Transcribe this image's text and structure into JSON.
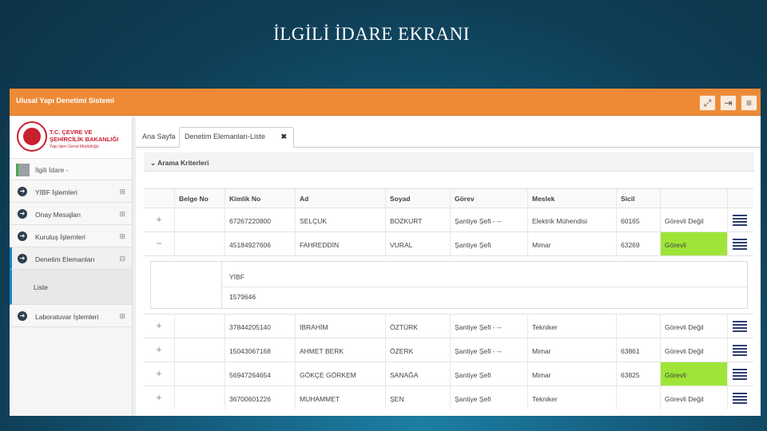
{
  "slide": {
    "title": "İLGİLİ İDARE EKRANI"
  },
  "app": {
    "title": "Ulusal Yapı Denetimi Sistemi",
    "colors": {
      "topbar": "#ee8a35",
      "highlight": "#9ee537",
      "accent": "#1a86c8"
    },
    "icons": [
      "fullscreen-icon",
      "logout-icon",
      "hamburger-menu-icon"
    ]
  },
  "logo": {
    "line1": "T.C. ÇEVRE VE",
    "line2": "ŞEHİRCİLİK BAKANLIĞI",
    "line3": "Yapı İşleri Genel Müdürlüğü"
  },
  "sidebar": {
    "user": "İlgili İdare -",
    "items": [
      {
        "label": "YİBF İşlemleri"
      },
      {
        "label": "Onay Mesajları"
      },
      {
        "label": "Kuruluş İşlemleri"
      },
      {
        "label": "Denetim Elemanları"
      },
      {
        "label": "Laboratuvar İşlemleri"
      }
    ],
    "submenu": "Liste"
  },
  "tabs": {
    "home": "Ana Sayfa",
    "active": "Denetim Elemanları-Liste"
  },
  "criteria": {
    "label": "Arama Kriterleri"
  },
  "table": {
    "headers": [
      "Belge No",
      "Kimlik No",
      "Ad",
      "Soyad",
      "Görev",
      "Meslek",
      "Sicil"
    ],
    "rows": [
      {
        "toggle": "+",
        "belge": "",
        "kimlik": "67267220800",
        "ad": "SELÇUK",
        "soyad": "BOZKURT",
        "gorev": "Şantiye Şefi - --",
        "meslek": "Elektrik Mühendisi",
        "sicil": "60165",
        "durum": "Görevli Değil",
        "green": false
      },
      {
        "toggle": "−",
        "belge": "",
        "kimlik": "45184927606",
        "ad": "FAHREDDİN",
        "soyad": "VURAL",
        "gorev": "Şantiye Şefi",
        "meslek": "Mimar",
        "sicil": "63269",
        "durum": "Görevli",
        "green": true
      },
      {
        "toggle": "+",
        "belge": "",
        "kimlik": "37844205140",
        "ad": "İBRAHİM",
        "soyad": "ÖZTÜRK",
        "gorev": "Şantiye Şefi - --",
        "meslek": "Tekniker",
        "sicil": "",
        "durum": "Görevli Değil",
        "green": false
      },
      {
        "toggle": "+",
        "belge": "",
        "kimlik": "15043067168",
        "ad": "AHMET BERK",
        "soyad": "ÖZERK",
        "gorev": "Şantiye Şefi - --",
        "meslek": "Mimar",
        "sicil": "63861",
        "durum": "Görevli Değil",
        "green": false
      },
      {
        "toggle": "+",
        "belge": "",
        "kimlik": "56947264654",
        "ad": "GÖKÇE GÖRKEM",
        "soyad": "SANAĞA",
        "gorev": "Şantiye Şefi",
        "meslek": "Mimar",
        "sicil": "63825",
        "durum": "Görevli",
        "green": true
      },
      {
        "toggle": "+",
        "belge": "",
        "kimlik": "36700601226",
        "ad": "MUHAMMET",
        "soyad": "ŞEN",
        "gorev": "Şantiye Şefi",
        "meslek": "Tekniker",
        "sicil": "",
        "durum": "Görevli Değil",
        "green": false
      }
    ],
    "detail": {
      "header": "YİBF",
      "value": "1579646"
    }
  }
}
